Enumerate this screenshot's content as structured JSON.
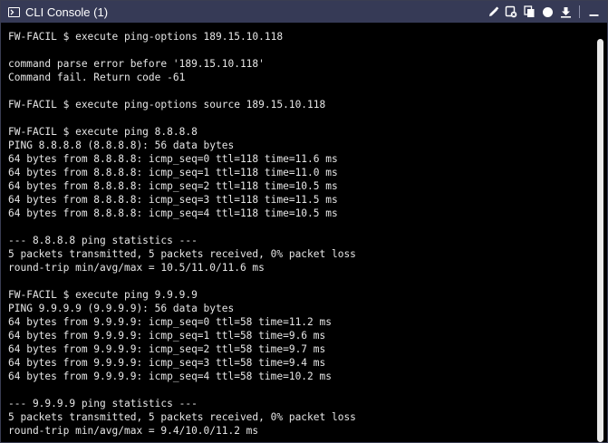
{
  "window": {
    "title": "CLI Console (1)",
    "icons": [
      "terminal-icon",
      "pencil-icon",
      "clear-icon",
      "copy-icon",
      "record-icon",
      "download-icon",
      "minimize-icon"
    ]
  },
  "console": {
    "lines": [
      "FW-FACIL $ execute ping-options 189.15.10.118",
      "",
      "command parse error before '189.15.10.118'",
      "Command fail. Return code -61",
      "",
      "FW-FACIL $ execute ping-options source 189.15.10.118",
      "",
      "FW-FACIL $ execute ping 8.8.8.8",
      "PING 8.8.8.8 (8.8.8.8): 56 data bytes",
      "64 bytes from 8.8.8.8: icmp_seq=0 ttl=118 time=11.6 ms",
      "64 bytes from 8.8.8.8: icmp_seq=1 ttl=118 time=11.0 ms",
      "64 bytes from 8.8.8.8: icmp_seq=2 ttl=118 time=10.5 ms",
      "64 bytes from 8.8.8.8: icmp_seq=3 ttl=118 time=11.5 ms",
      "64 bytes from 8.8.8.8: icmp_seq=4 ttl=118 time=10.5 ms",
      "",
      "--- 8.8.8.8 ping statistics ---",
      "5 packets transmitted, 5 packets received, 0% packet loss",
      "round-trip min/avg/max = 10.5/11.0/11.6 ms",
      "",
      "FW-FACIL $ execute ping 9.9.9.9",
      "PING 9.9.9.9 (9.9.9.9): 56 data bytes",
      "64 bytes from 9.9.9.9: icmp_seq=0 ttl=58 time=11.2 ms",
      "64 bytes from 9.9.9.9: icmp_seq=1 ttl=58 time=9.6 ms",
      "64 bytes from 9.9.9.9: icmp_seq=2 ttl=58 time=9.7 ms",
      "64 bytes from 9.9.9.9: icmp_seq=3 ttl=58 time=9.4 ms",
      "64 bytes from 9.9.9.9: icmp_seq=4 ttl=58 time=10.2 ms",
      "",
      "--- 9.9.9.9 ping statistics ---",
      "5 packets transmitted, 5 packets received, 0% packet loss",
      "round-trip min/avg/max = 9.4/10.0/11.2 ms"
    ]
  },
  "colors": {
    "titlebar_bg": "#363a56",
    "console_bg": "#000000",
    "console_text": "#e6e6e6"
  }
}
